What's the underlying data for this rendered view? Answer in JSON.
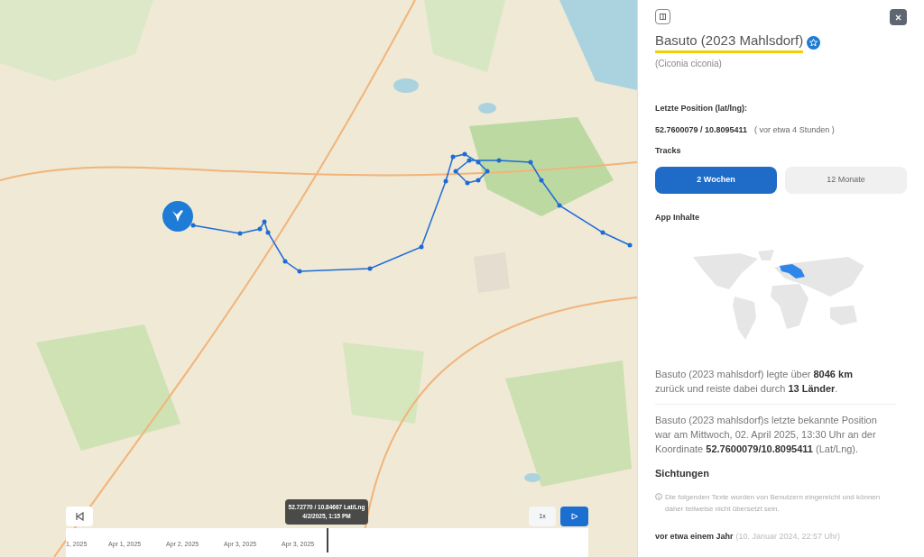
{
  "panel": {
    "title": "Basuto (2023 Mahlsdorf)",
    "species": "(Ciconia ciconia)",
    "position_label": "Letzte Position (lat/lng):",
    "position": "52.7600079 / 10.8095411",
    "position_age": "( vor etwa 4 Stunden )",
    "tracks_label": "Tracks",
    "tabs": [
      {
        "label": "2 Wochen",
        "selected": true
      },
      {
        "label": "12 Monate",
        "selected": false
      }
    ],
    "app_label": "App Inhalte",
    "summary": "Basuto (2023 mahlsdorf) legte über **8046 km** zurück und reiste dabei durch **13 Länder**.",
    "last_seen": "Basuto (2023 mahlsdorf)s letzte bekannte Position war am Mittwoch, 02. April 2025, 13:30 Uhr an der Koordinate **52.7600079/10.8095411** (Lat/Lng).",
    "sightings_title": "Sichtungen",
    "notice": "Die folgenden Texte wurden von Benutzern eingereicht und können daher teilweise nicht übersetzt sein.",
    "sighting_when": "vor etwa einem Jahr",
    "sighting_date": "(10. Januar 2024, 22:57 Uhr)"
  },
  "timeline": {
    "tooltip_coords": "52.72770 / 10.84667 Lat/Lng",
    "tooltip_time": "4/2/2025, 1:15 PM",
    "ticks": [
      "1, 2025",
      "Apr 1, 2025",
      "Apr 2, 2025",
      "Apr 3, 2025",
      "Apr 3, 2025"
    ],
    "speed": "1x"
  }
}
